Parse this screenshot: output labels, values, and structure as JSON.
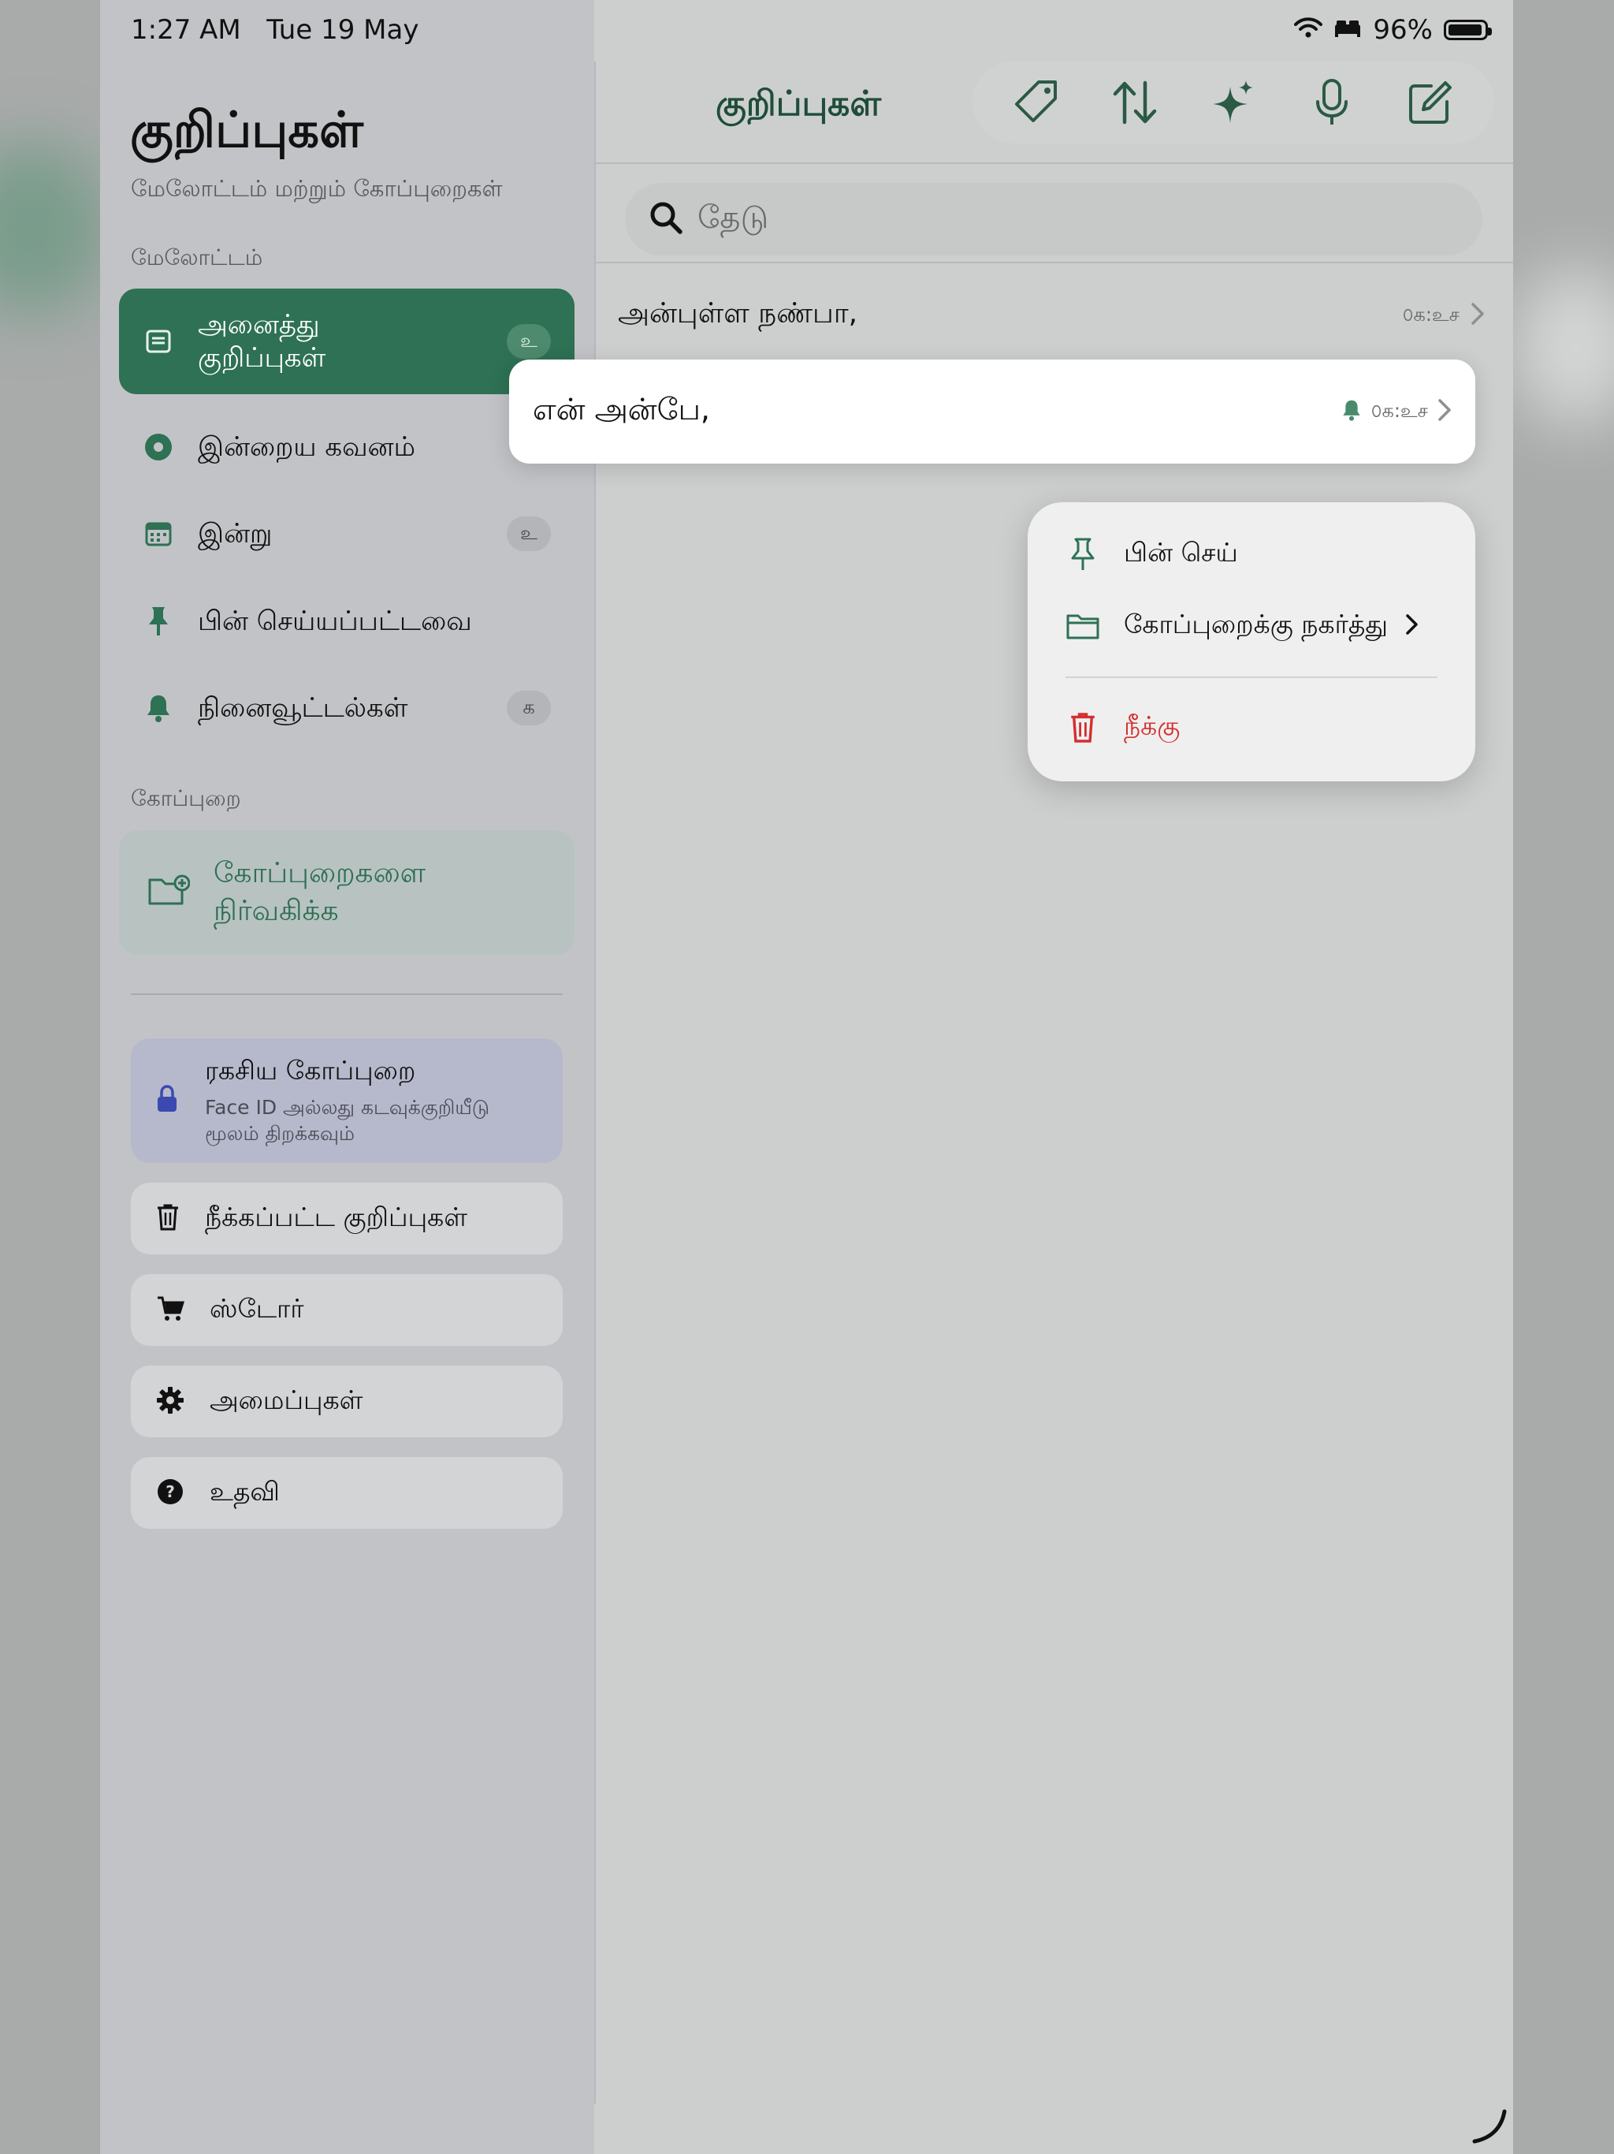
{
  "status_bar": {
    "time": "1:27 AM",
    "date": "Tue 19 May",
    "battery": "96%",
    "battery_level": 0.96
  },
  "sidebar": {
    "title": "குறிப்புகள்",
    "subtitle": "மேலோட்டம் மற்றும் கோப்புறைகள்",
    "overview_label": "மேலோட்டம்",
    "items": [
      {
        "label": "அனைத்து குறிப்புகள்",
        "badge": "உ",
        "icon": "note-icon",
        "active": true
      },
      {
        "label": "இன்றைய கவனம்",
        "badge": "",
        "icon": "target-icon"
      },
      {
        "label": "இன்று",
        "badge": "உ",
        "icon": "calendar-icon"
      },
      {
        "label": "பின் செய்யப்பட்டவை",
        "badge": "",
        "icon": "pin-icon"
      },
      {
        "label": "நினைவூட்டல்கள்",
        "badge": "க",
        "icon": "bell-icon"
      }
    ],
    "folder_label": "கோப்புறை",
    "manage_folders": "கோப்புறைகளை நிர்வகிக்க",
    "secret_folder": {
      "title": "ரகசிய கோப்புறை",
      "subtitle": "Face ID அல்லது கடவுக்குறியீடு மூலம் திறக்கவும்"
    },
    "deleted_notes": "நீக்கப்பட்ட குறிப்புகள்",
    "store": "ஸ்டோர்",
    "settings": "அமைப்புகள்",
    "help": "உதவி"
  },
  "main": {
    "title": "குறிப்புகள்",
    "search_placeholder": "தேடு",
    "notes": [
      {
        "title": "அன்புள்ள நண்பா,",
        "time": "௦க:உச"
      },
      {
        "title": "என் அன்பே,",
        "time": "௦க:உச",
        "reminder": true
      }
    ]
  },
  "context_menu": {
    "pin": "பின் செய்",
    "move": "கோப்புறைக்கு நகர்த்து",
    "delete": "நீக்கு"
  },
  "colors": {
    "accent": "#2e7154",
    "danger": "#d32f2f",
    "lock": "#3b4ab0"
  }
}
